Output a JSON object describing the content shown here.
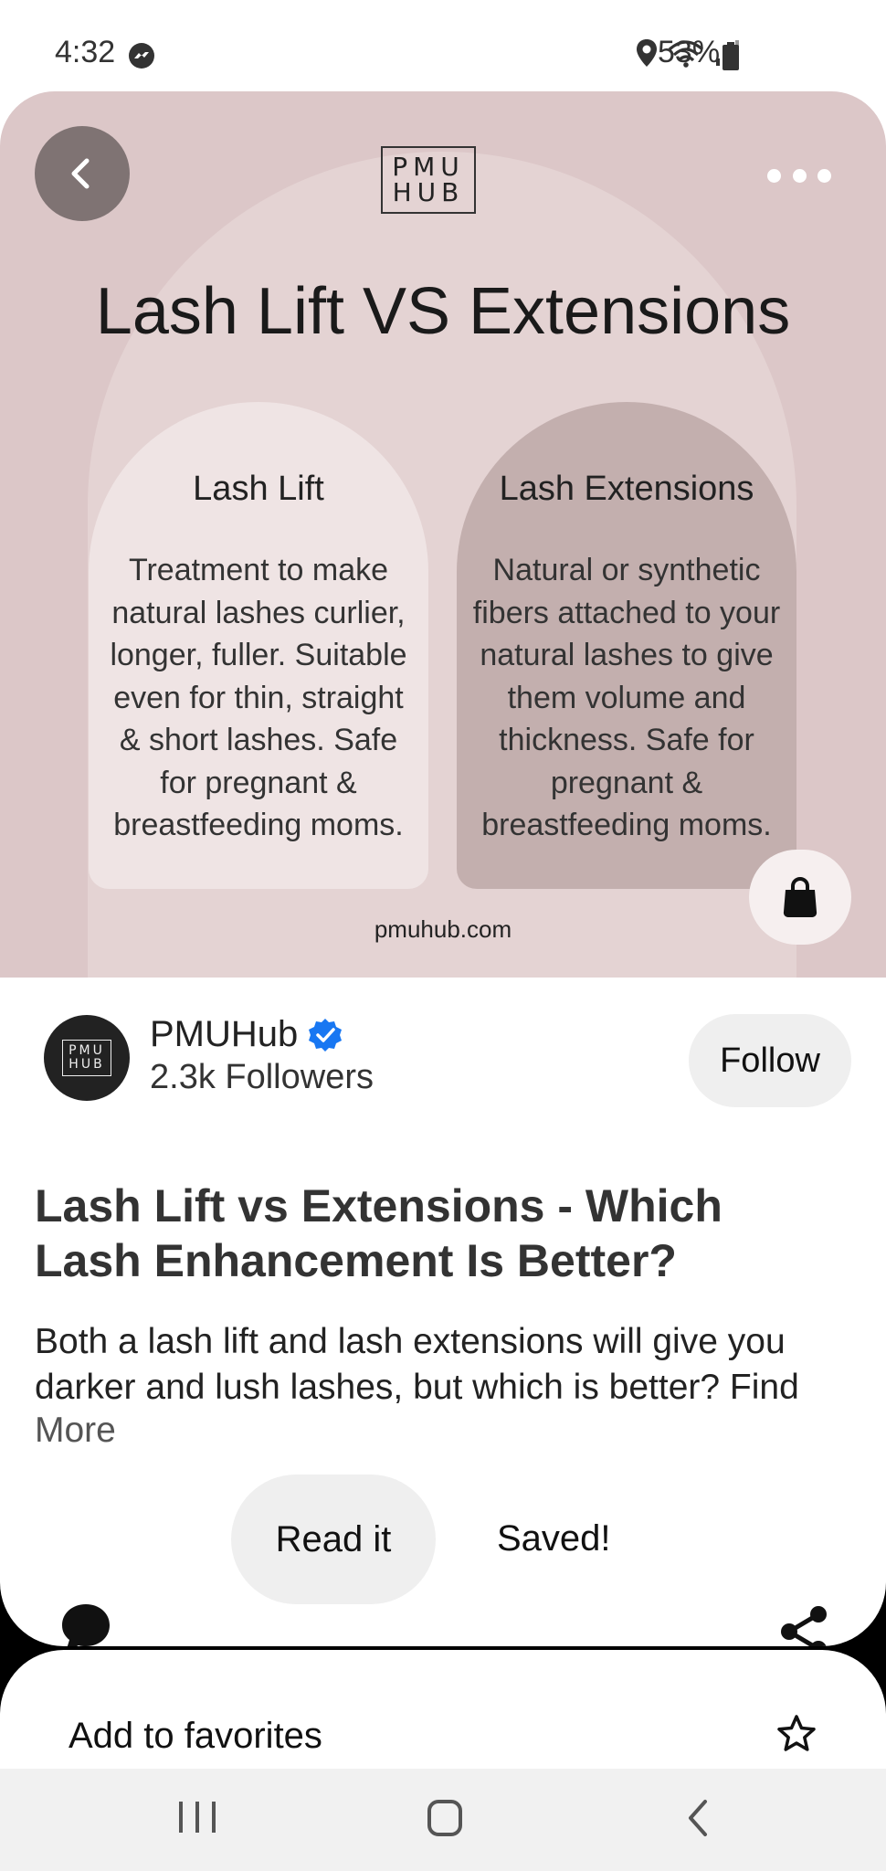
{
  "status_bar": {
    "time": "4:32",
    "battery": "53%"
  },
  "pin": {
    "logo_line1": "PMU",
    "logo_line2": "HUB",
    "headline": "Lash Lift VS Extensions",
    "left_column": {
      "title": "Lash Lift",
      "body": "Treatment to make natural lashes curlier, longer, fuller. Suitable even for thin, straight & short lashes. Safe for pregnant & breastfeeding moms."
    },
    "right_column": {
      "title": "Lash Extensions",
      "body": "Natural or synthetic fibers attached to your natural lashes to give them volume and thickness. Safe for pregnant & breastfeeding moms."
    },
    "site_url": "pmuhub.com"
  },
  "creator": {
    "avatar_line1": "PMU",
    "avatar_line2": "HUB",
    "name": "PMUHub",
    "followers": "2.3k Followers",
    "follow_label": "Follow"
  },
  "details": {
    "title": "Lash Lift vs Extensions - Which Lash Enhancement Is Better?",
    "description": "Both a lash lift and lash extensions will give you darker and lush lashes, but which is better? Find",
    "more_label": "More"
  },
  "actions": {
    "read_label": "Read it",
    "saved_label": "Saved!"
  },
  "favorites": {
    "label": "Add to favorites"
  },
  "colors": {
    "pin_background": "#dcc7c8",
    "left_card": "#efe4e4",
    "right_card": "#c3afae",
    "verified_badge": "#1877f2"
  },
  "icons": [
    "messenger-icon",
    "location-icon",
    "wifi-icon",
    "signal-icon",
    "battery-icon",
    "back-arrow-icon",
    "more-dots-icon",
    "shopping-bag-icon",
    "verified-badge-icon",
    "comment-icon",
    "share-icon",
    "star-icon",
    "recent-apps-icon",
    "home-icon",
    "nav-back-icon"
  ]
}
